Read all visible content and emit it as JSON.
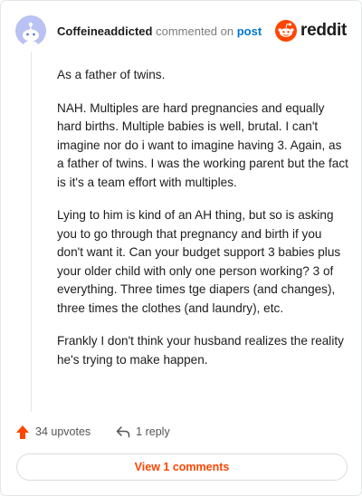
{
  "comment": {
    "username": "Coffeineaddicted",
    "action_text": "commented on",
    "target_link": "post",
    "paragraphs": [
      "As a father of twins.",
      "NAH. Multiples are hard pregnancies and equally hard births. Multiple babies is well, brutal. I can't imagine nor do i want to imagine having 3. Again, as a father of twins. I was the working parent but the fact is it's a team effort with multiples.",
      "Lying to him is kind of an AH thing, but so is asking you to go through that pregnancy and birth if you don't want it. Can your budget support 3 babies plus your older child with only one person working? 3 of everything. Three times tge diapers (and changes), three times the clothes (and laundry), etc.",
      "Frankly I don't think your husband realizes the reality he's trying to make happen."
    ]
  },
  "brand": {
    "wordmark": "reddit",
    "color": "#ff4500"
  },
  "actions": {
    "upvotes": "34 upvotes",
    "replies": "1 reply",
    "view_comments": "View 1 comments"
  },
  "icons": {
    "avatar": "reddit-default-avatar-icon",
    "logo": "reddit-snoo-logo-icon",
    "upvote": "upvote-arrow-icon",
    "reply": "reply-arrow-icon"
  },
  "colors": {
    "accent": "#ff4500",
    "link": "#0079d3",
    "avatar_bg": "#b9c2f2"
  }
}
